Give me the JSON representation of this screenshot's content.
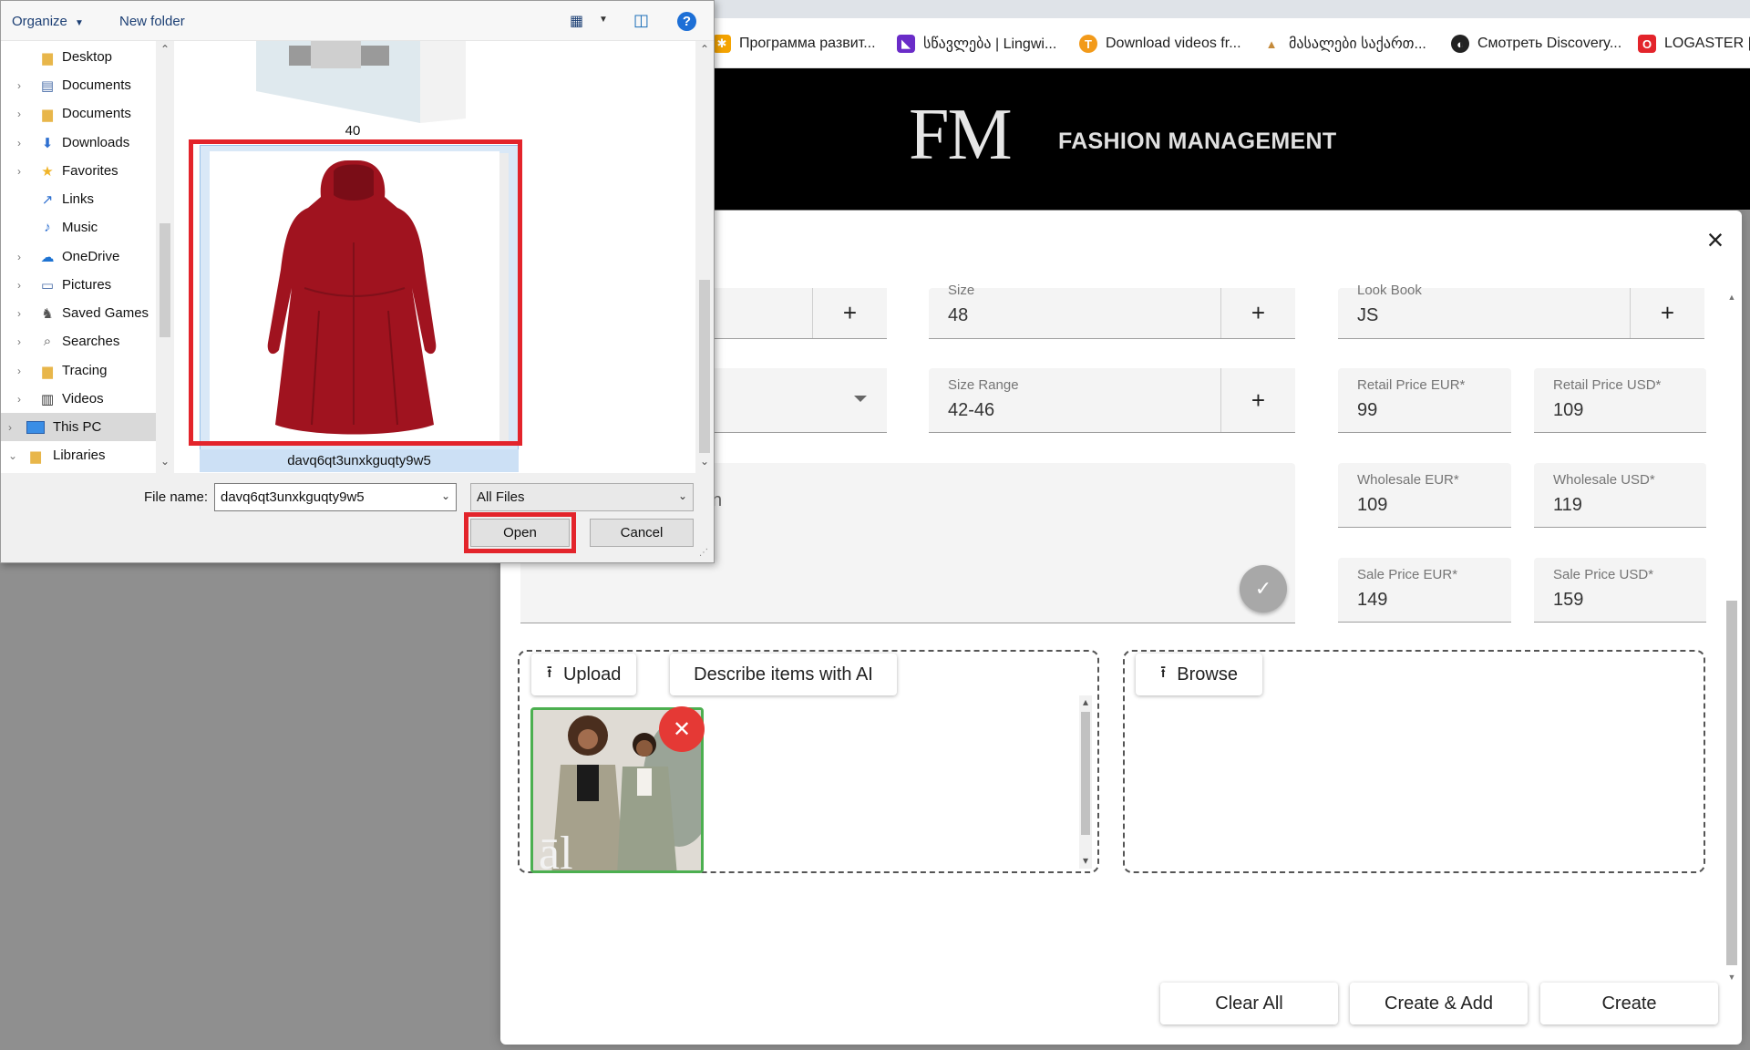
{
  "browser": {
    "bookmarks": [
      {
        "label": "Программа развит...",
        "icon": "pinwheel-favicon",
        "color": "#f4a300"
      },
      {
        "label": "სწავლება | Lingwi...",
        "icon": "lingwing-favicon",
        "color": "#6a2cc8"
      },
      {
        "label": "Download videos fr...",
        "icon": "download-favicon",
        "color": "#f29a1a"
      },
      {
        "label": "მასალები საქართ...",
        "icon": "mountain-favicon",
        "color": "#c48a3a"
      },
      {
        "label": "Смотреть Discovery...",
        "icon": "globe-favicon",
        "color": "#222222"
      },
      {
        "label": "LOGASTER | С",
        "icon": "logaster-favicon",
        "color": "#e3242b"
      }
    ]
  },
  "site": {
    "logo": "FM",
    "brand": "FASHION MANAGEMENT"
  },
  "form": {
    "size_label": "Size",
    "size_value": "48",
    "lookbook_label": "Look Book",
    "lookbook_value": "JS",
    "size_range_label": "Size Range",
    "size_range_value": "42-46",
    "retail_eur_label": "Retail Price EUR*",
    "retail_eur_value": "99",
    "retail_usd_label": "Retail Price USD*",
    "retail_usd_value": "109",
    "wholesale_eur_label": "Wholesale EUR*",
    "wholesale_eur_value": "109",
    "wholesale_usd_label": "Wholesale USD*",
    "wholesale_usd_value": "119",
    "sale_eur_label": "Sale Price EUR*",
    "sale_eur_value": "149",
    "sale_usd_label": "Sale Price USD*",
    "sale_usd_value": "159",
    "description_fragment": "n",
    "plus": "+",
    "upload_label": "Upload",
    "describe_label": "Describe items with AI",
    "browse_label": "Browse",
    "thumb_caption": "āl",
    "clear_all": "Clear All",
    "create_add": "Create & Add",
    "create": "Create"
  },
  "dialog": {
    "organize": "Organize",
    "new_folder": "New folder",
    "help": "?",
    "nav_items": [
      {
        "label": "Desktop",
        "icon": "folder-icon"
      },
      {
        "label": "Documents",
        "icon": "documents-icon"
      },
      {
        "label": "Documents",
        "icon": "folder-icon"
      },
      {
        "label": "Downloads",
        "icon": "download-arrow-icon"
      },
      {
        "label": "Favorites",
        "icon": "star-icon"
      },
      {
        "label": "Links",
        "icon": "link-icon"
      },
      {
        "label": "Music",
        "icon": "music-note-icon"
      },
      {
        "label": "OneDrive",
        "icon": "cloud-icon"
      },
      {
        "label": "Pictures",
        "icon": "pictures-icon"
      },
      {
        "label": "Saved Games",
        "icon": "games-icon"
      },
      {
        "label": "Searches",
        "icon": "search-icon"
      },
      {
        "label": "Tracing",
        "icon": "folder-icon"
      },
      {
        "label": "Videos",
        "icon": "film-icon"
      },
      {
        "label": "This PC",
        "icon": "computer-icon"
      },
      {
        "label": "Libraries",
        "icon": "libraries-icon"
      }
    ],
    "file_above_label": "40",
    "selected_file_label": "davq6qt3unxkguqty9w5",
    "file_name_label": "File name:",
    "file_name_value": "davq6qt3unxkguqty9w5",
    "file_type": "All Files",
    "open": "Open",
    "cancel": "Cancel"
  }
}
